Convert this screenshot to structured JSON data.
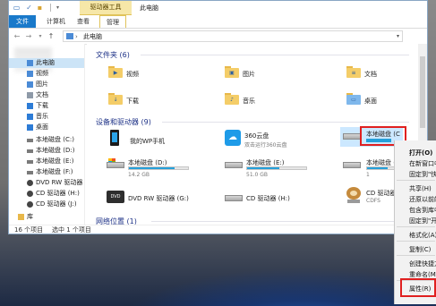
{
  "window": {
    "title": "此电脑"
  },
  "titlebar": {
    "context_tab_title": "驱动器工具"
  },
  "ribbon": {
    "tabs": [
      {
        "label": "文件"
      },
      {
        "label": "计算机"
      },
      {
        "label": "查看"
      },
      {
        "label": "管理"
      }
    ]
  },
  "address": {
    "path": "此电脑"
  },
  "sidebar": {
    "items": [
      {
        "label": "此电脑",
        "icon": "pc-icon",
        "color": "#4b8bd6"
      },
      {
        "label": "视频",
        "icon": "video-icon",
        "color": "#4b8bd6"
      },
      {
        "label": "图片",
        "icon": "picture-icon",
        "color": "#4b8bd6"
      },
      {
        "label": "文档",
        "icon": "document-icon",
        "color": "#8e9aa8"
      },
      {
        "label": "下载",
        "icon": "download-icon",
        "color": "#2d7cd6"
      },
      {
        "label": "音乐",
        "icon": "music-icon",
        "color": "#2d7cd6"
      },
      {
        "label": "桌面",
        "icon": "desktop-icon",
        "color": "#2d7cd6"
      },
      {
        "label": "本地磁盘 (C:)",
        "icon": "drive-icon",
        "color": "#7a7a7a"
      },
      {
        "label": "本地磁盘 (D:)",
        "icon": "drive-icon",
        "color": "#7a7a7a"
      },
      {
        "label": "本地磁盘 (E:)",
        "icon": "drive-icon",
        "color": "#7a7a7a"
      },
      {
        "label": "本地磁盘 (F:)",
        "icon": "drive-icon",
        "color": "#7a7a7a"
      },
      {
        "label": "DVD RW 驱动器",
        "icon": "dvd-icon",
        "color": "#444444"
      },
      {
        "label": "CD 驱动器 (H:)",
        "icon": "cd-icon",
        "color": "#444444"
      },
      {
        "label": "CD 驱动器 (J:)",
        "icon": "cd-icon",
        "color": "#444444"
      },
      {
        "label": "库",
        "icon": "library-icon",
        "color": "#e8b84a"
      }
    ]
  },
  "groups": {
    "folders": "文件夹 (6)",
    "devices": "设备和驱动器 (9)",
    "network": "网络位置 (1)"
  },
  "folders": [
    {
      "label": "视频"
    },
    {
      "label": "图片"
    },
    {
      "label": "文档"
    },
    {
      "label": "下载"
    },
    {
      "label": "音乐"
    },
    {
      "label": "桌面"
    }
  ],
  "devices": {
    "phone": "我的WP手机",
    "cloud": "360云盘",
    "cloud_sub": "双击运行360云盘",
    "drive_c": "本地磁盘 (C",
    "drive_d": "本地磁盘 (D:)",
    "drive_d_free": "14.2 GB",
    "drive_d_fill": 0.78,
    "drive_e": "本地磁盘 (E:)",
    "drive_e_free": "51.0 GB",
    "drive_e_fill": 0.55,
    "drive_f": "本地磁盘 (F",
    "drive_f_free": "1",
    "drive_f_fill": 0.6,
    "dvd": "DVD RW 驱动器 (G:)",
    "cd_h": "CD 驱动器 (H:)",
    "cd_j": "CD 驱动器",
    "cd_j_sub": "CDFS",
    "colors": {
      "accent": "#26a0da",
      "highlight_red": "#e02020",
      "cloud": "#1e9be8"
    }
  },
  "status": {
    "count": "16 个项目",
    "selected": "选中 1 个项目"
  },
  "context_menu": {
    "items": [
      {
        "label": "打开(O)"
      },
      {
        "label": "在新窗口中"
      },
      {
        "label": "固定到\"快"
      },
      {
        "label": "共享(H)"
      },
      {
        "label": "还原以前的"
      },
      {
        "label": "包含到库中"
      },
      {
        "label": "固定到\"开"
      },
      {
        "label": "格式化(A)"
      },
      {
        "label": "复制(C)"
      },
      {
        "label": "创建快捷方"
      },
      {
        "label": "重命名(M)"
      },
      {
        "label": "属性(R)"
      }
    ]
  }
}
